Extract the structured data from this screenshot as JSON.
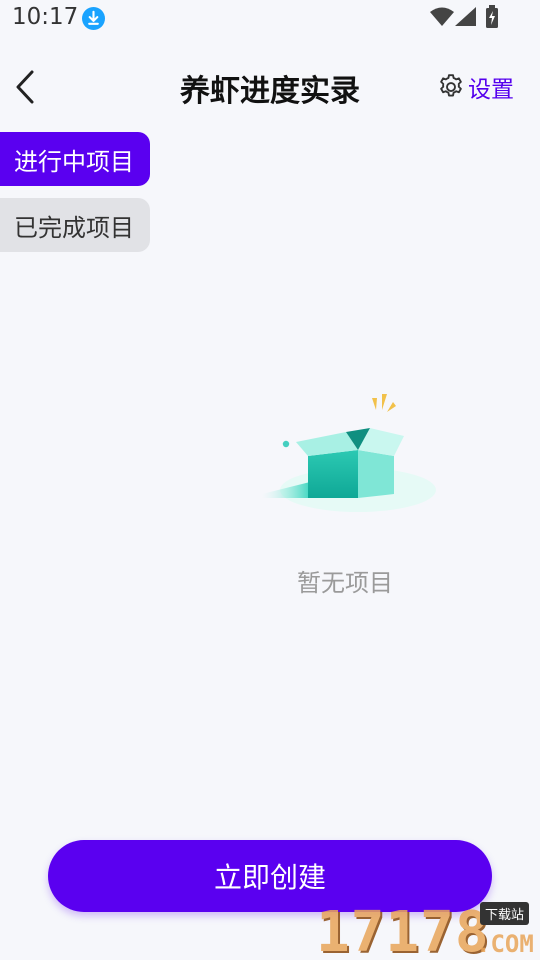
{
  "status_bar": {
    "time": "10:17",
    "icons": [
      "download-icon",
      "wifi-icon",
      "signal-icon",
      "battery-icon"
    ]
  },
  "header": {
    "title": "养虾进度实录",
    "back_icon": "chevron-left-icon",
    "settings_label": "设置",
    "settings_icon": "gear-icon"
  },
  "tabs": [
    {
      "label": "进行中项目",
      "active": true
    },
    {
      "label": "已完成项目",
      "active": false
    }
  ],
  "empty_state": {
    "text": "暂无项目",
    "illustration": "open-box-illustration"
  },
  "actions": {
    "create_label": "立即创建"
  },
  "watermark": {
    "number": "17178",
    "tag": "下载站",
    "suffix": ".COM"
  },
  "colors": {
    "accent": "#5a00f0",
    "background": "#f6f7fb",
    "inactive_tab": "#e1e2e6",
    "muted_text": "#9a9a9a"
  }
}
